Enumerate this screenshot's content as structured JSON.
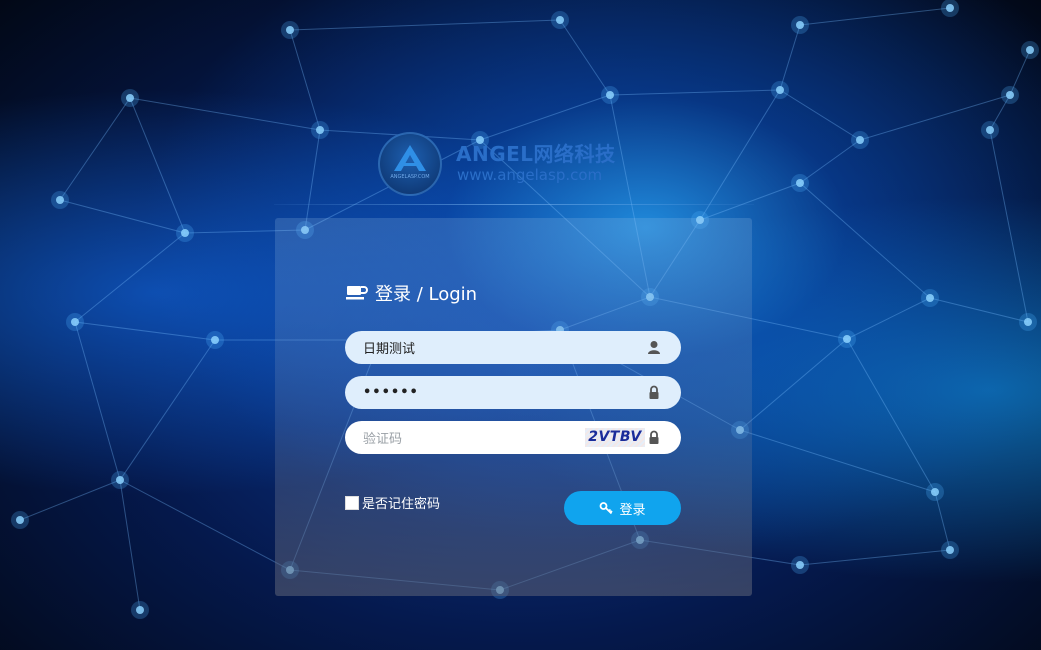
{
  "brand": {
    "name": "ANGEL网络科技",
    "url": "www.angelasp.com",
    "emblem_text": "ANGELASP.COM"
  },
  "login": {
    "title": "登录 / Login",
    "username_value": "日期测试",
    "password_value": "••••••",
    "captcha_placeholder": "验证码",
    "captcha_code": "2VTBV",
    "remember_label": "是否记住密码",
    "submit_label": "登录"
  },
  "colors": {
    "button": "#10a4ee",
    "brand": "#2a6ec8",
    "input_fill": "#dfeefc"
  },
  "icons": [
    "coffee-cup-icon",
    "user-icon",
    "lock-icon",
    "key-icon"
  ]
}
